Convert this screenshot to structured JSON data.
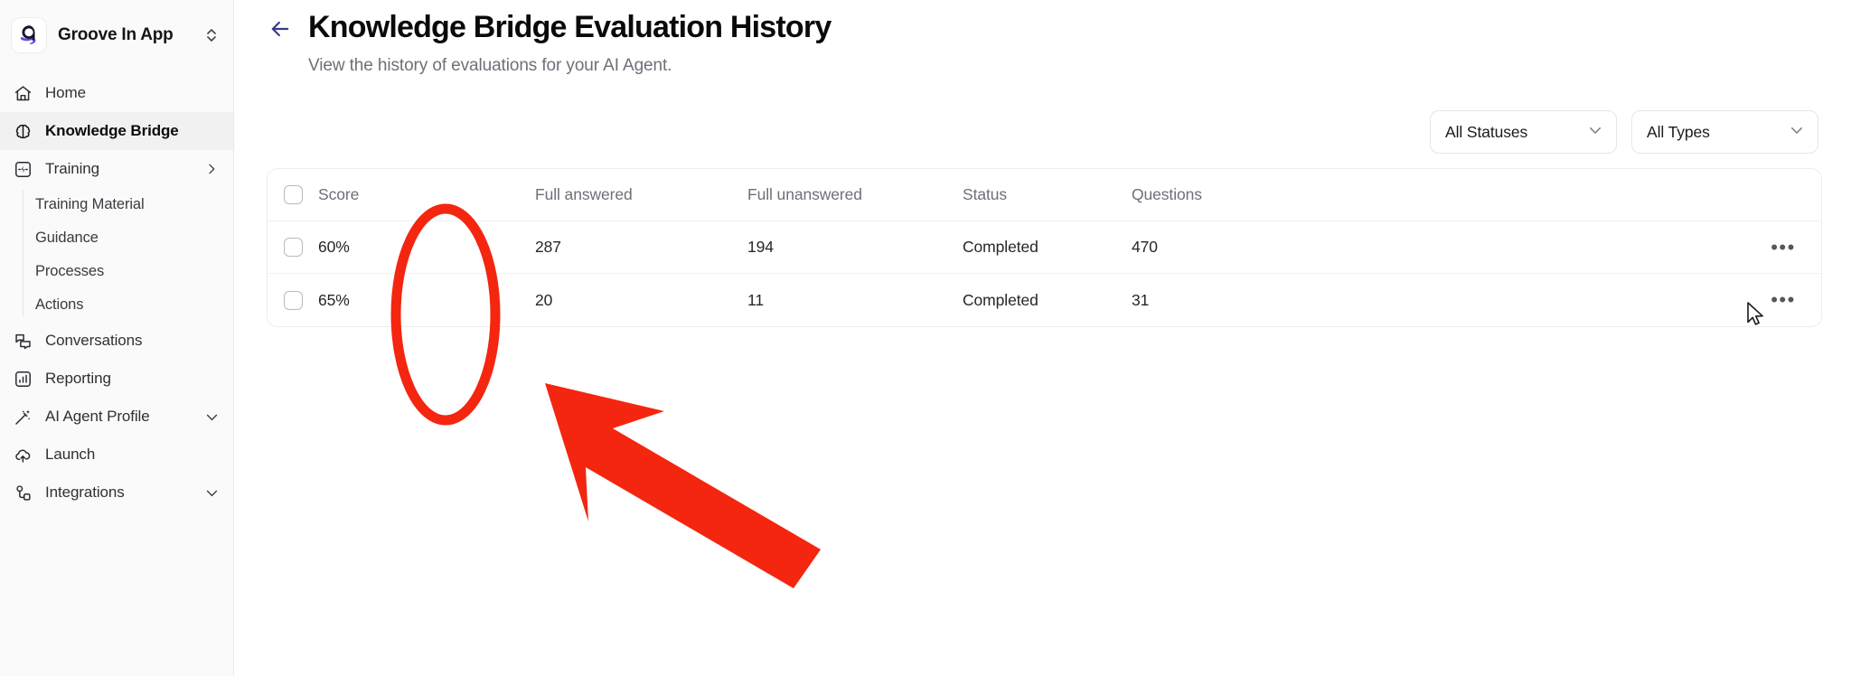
{
  "sidebar": {
    "workspace": {
      "name": "Groove In App",
      "logo_icon": "groove-g-logo",
      "switcher_icon": "chevron-up-down-icon"
    },
    "items": [
      {
        "label": "Home",
        "icon": "home-icon",
        "active": false,
        "chevron": null
      },
      {
        "label": "Knowledge Bridge",
        "icon": "brain-icon",
        "active": true,
        "chevron": null
      },
      {
        "label": "Training",
        "icon": "training-bolt-icon",
        "active": false,
        "chevron": "chevron-right-icon"
      },
      {
        "label": "Conversations",
        "icon": "chat-bubbles-icon",
        "active": false,
        "chevron": null
      },
      {
        "label": "Reporting",
        "icon": "bar-chart-icon",
        "active": false,
        "chevron": null
      },
      {
        "label": "AI Agent Profile",
        "icon": "magic-wand-icon",
        "active": false,
        "chevron": "chevron-down-icon"
      },
      {
        "label": "Launch",
        "icon": "cloud-upload-icon",
        "active": false,
        "chevron": null
      },
      {
        "label": "Integrations",
        "icon": "integrations-nodes-icon",
        "active": false,
        "chevron": "chevron-down-icon"
      }
    ],
    "training_subitems": [
      {
        "label": "Training Material"
      },
      {
        "label": "Guidance"
      },
      {
        "label": "Processes"
      },
      {
        "label": "Actions"
      }
    ]
  },
  "header": {
    "back_icon": "arrow-left-icon",
    "title": "Knowledge Bridge Evaluation History",
    "subtitle": "View the history of evaluations for your AI Agent."
  },
  "filters": [
    {
      "name": "status-filter",
      "value": "All Statuses",
      "icon": "chevron-down-icon"
    },
    {
      "name": "type-filter",
      "value": "All Types",
      "icon": "chevron-down-icon"
    }
  ],
  "table": {
    "select_all_checkbox": false,
    "columns": [
      "Score",
      "Full answered",
      "Full unanswered",
      "Status",
      "Questions"
    ],
    "rows": [
      {
        "checked": false,
        "score": "60%",
        "full_answered": "287",
        "full_unanswered": "194",
        "status": "Completed",
        "questions": "470",
        "more_icon": "ellipsis-icon"
      },
      {
        "checked": false,
        "score": "65%",
        "full_answered": "20",
        "full_unanswered": "11",
        "status": "Completed",
        "questions": "31",
        "more_icon": "ellipsis-icon"
      }
    ]
  },
  "annotations": {
    "color": "#F4260F",
    "ellipse": {
      "name": "score-column-highlight-ellipse"
    },
    "arrow": {
      "name": "score-column-pointer-arrow"
    }
  },
  "cursor": {
    "icon": "mouse-pointer-icon"
  },
  "colors": {
    "accent": "#4B3FD4",
    "sidebar_bg": "#FAFAFA",
    "active_item_bg": "#F1F1F2",
    "annotation_red": "#F4260F",
    "text_primary": "#0A0A0C",
    "text_muted": "#6F6F79",
    "border": "#EDEDEF"
  }
}
